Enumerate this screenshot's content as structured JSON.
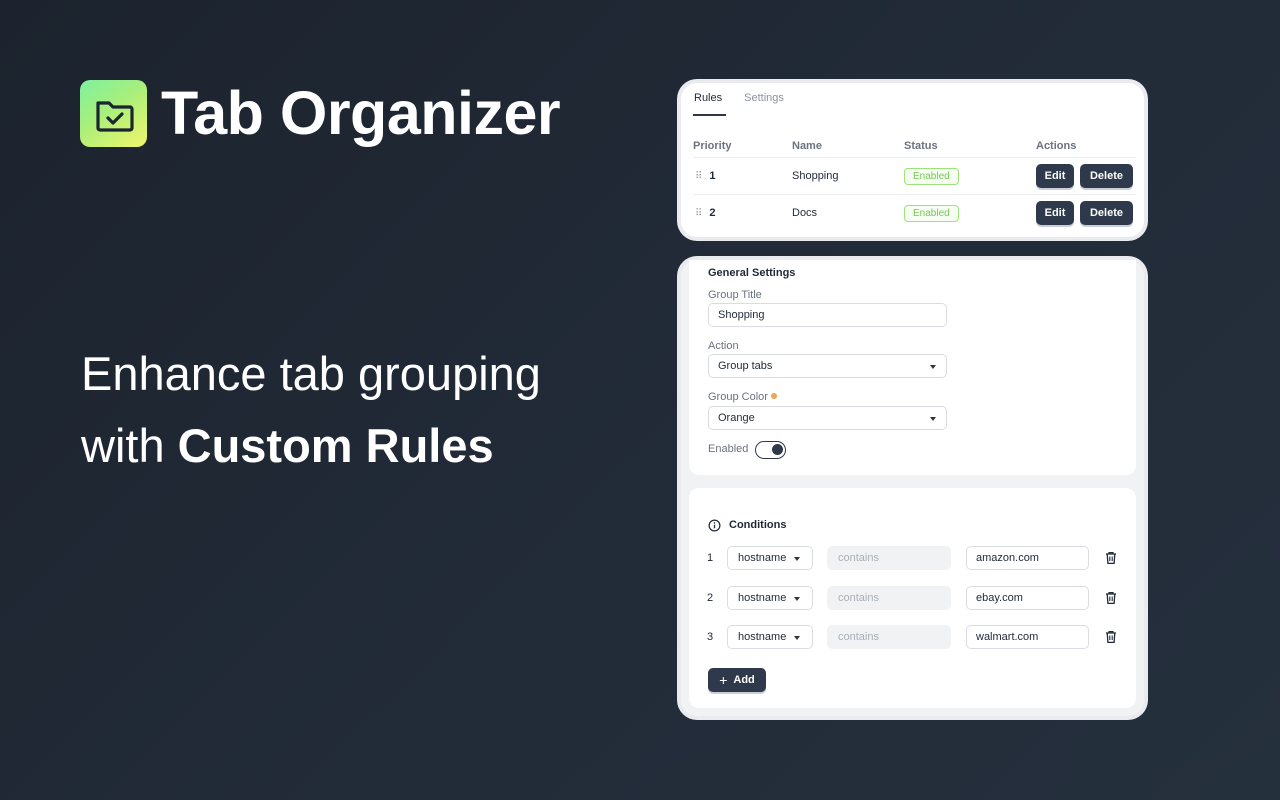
{
  "brand": {
    "title": "Tab Organizer",
    "logo_icon": "folder-check-icon"
  },
  "tagline": {
    "line1": "Enhance tab grouping",
    "line2_prefix": "with ",
    "line2_bold": "Custom Rules"
  },
  "tabs": [
    {
      "label": "Rules",
      "active": true
    },
    {
      "label": "Settings",
      "active": false
    }
  ],
  "rules_table": {
    "headers": {
      "priority": "Priority",
      "name": "Name",
      "status": "Status",
      "actions": "Actions"
    },
    "rows": [
      {
        "priority": "1",
        "name": "Shopping",
        "status": "Enabled"
      },
      {
        "priority": "2",
        "name": "Docs",
        "status": "Enabled"
      }
    ],
    "edit_label": "Edit",
    "delete_label": "Delete"
  },
  "general": {
    "title": "General Settings",
    "group_title_label": "Group Title",
    "group_title_value": "Shopping",
    "action_label": "Action",
    "action_value": "Group tabs",
    "group_color_label": "Group Color",
    "group_color_value": "Orange",
    "group_color_hex": "#f4a259",
    "enabled_label": "Enabled",
    "enabled_on": true
  },
  "conditions": {
    "title": "Conditions",
    "rows": [
      {
        "num": "1",
        "field": "hostname",
        "operator": "contains",
        "value": "amazon.com"
      },
      {
        "num": "2",
        "field": "hostname",
        "operator": "contains",
        "value": "ebay.com"
      },
      {
        "num": "3",
        "field": "hostname",
        "operator": "contains",
        "value": "walmart.com"
      }
    ],
    "add_label": "Add"
  },
  "colors": {
    "accent_dark": "#2e3a4b",
    "enabled_green": "#76c955",
    "background": "#1f2733"
  }
}
